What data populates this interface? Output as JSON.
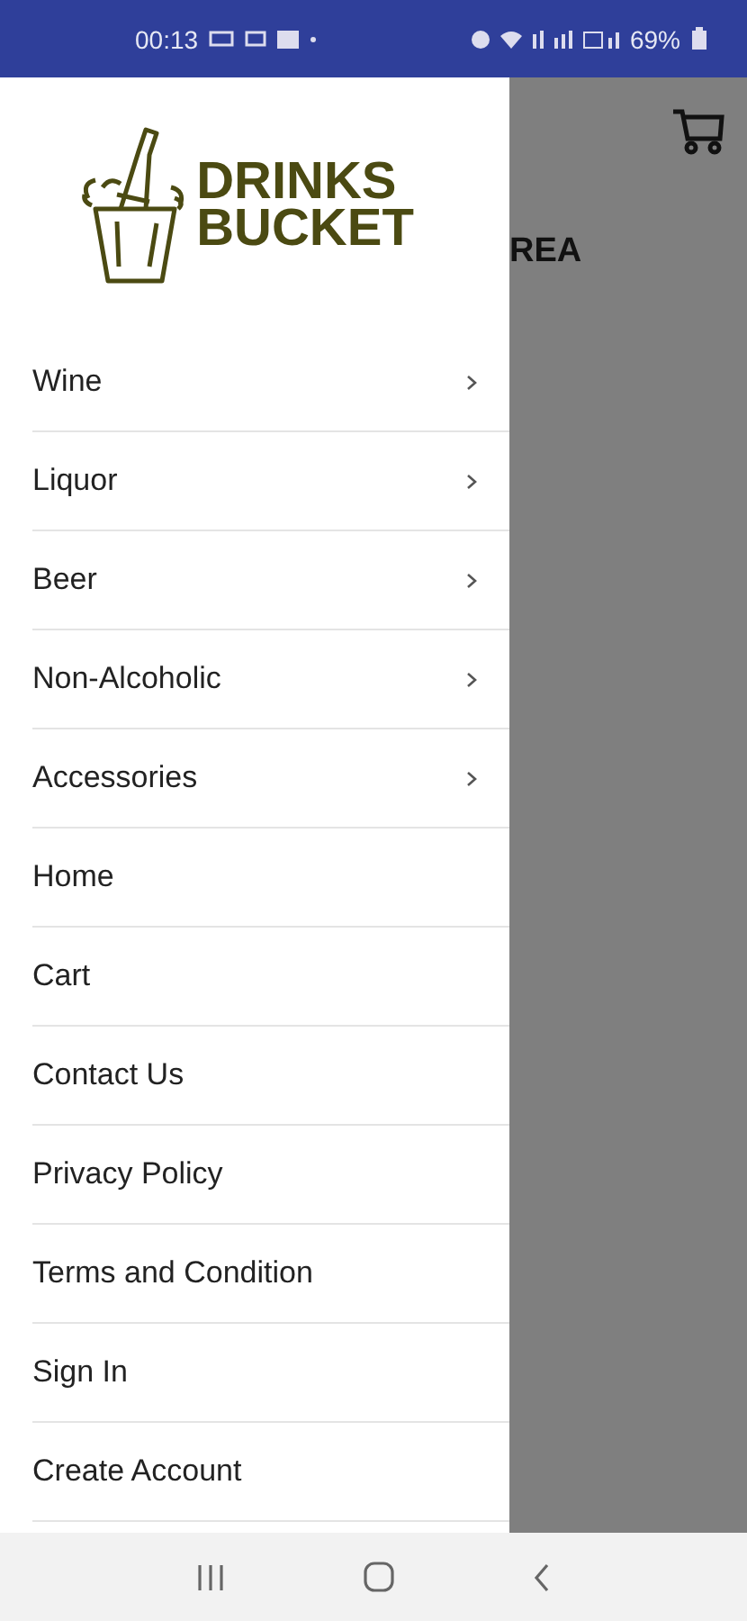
{
  "status_bar": {
    "time": "00:13",
    "battery": "69%"
  },
  "drawer": {
    "logo": {
      "line1": "DRINKS",
      "line2": "BUCKET"
    },
    "items": [
      {
        "label": "Wine",
        "has_submenu": true
      },
      {
        "label": "Liquor",
        "has_submenu": true
      },
      {
        "label": "Beer",
        "has_submenu": true
      },
      {
        "label": "Non-Alcoholic",
        "has_submenu": true
      },
      {
        "label": "Accessories",
        "has_submenu": true
      },
      {
        "label": "Home",
        "has_submenu": false
      },
      {
        "label": "Cart",
        "has_submenu": false
      },
      {
        "label": "Contact Us",
        "has_submenu": false
      },
      {
        "label": "Privacy Policy",
        "has_submenu": false
      },
      {
        "label": "Terms and Condition",
        "has_submenu": false
      },
      {
        "label": "Sign In",
        "has_submenu": false
      },
      {
        "label": "Create Account",
        "has_submenu": false
      }
    ]
  },
  "background": {
    "heading": "REA"
  }
}
